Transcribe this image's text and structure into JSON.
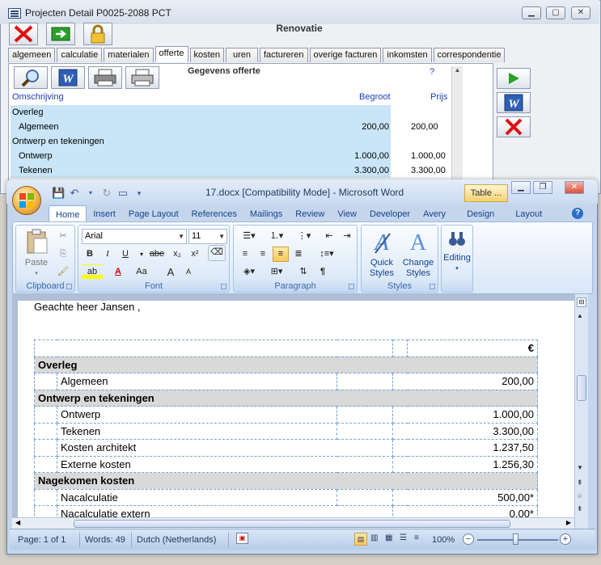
{
  "back_window": {
    "title": "Projecten Detail   P0025-2088   PCT",
    "header": "Renovatie",
    "tabs": [
      "algemeen",
      "calculatie",
      "materialen",
      "offerte",
      "kosten",
      "uren",
      "factureren",
      "overige facturen",
      "inkomsten",
      "correspondentie"
    ],
    "active_tab": "offerte",
    "section_title": "Gegevens offerte",
    "help_mark": "?",
    "columns": {
      "omschrijving": "Omschrijving",
      "begroot": "Begroot",
      "prijs": "Prijs"
    },
    "rows": [
      {
        "label": "Overleg",
        "begroot": "",
        "prijs": ""
      },
      {
        "label": "Algemeen",
        "begroot": "200,00",
        "prijs": "200,00"
      },
      {
        "label": "Ontwerp en tekeningen",
        "begroot": "",
        "prijs": ""
      },
      {
        "label": "Ontwerp",
        "begroot": "1.000,00",
        "prijs": "1.000,00"
      },
      {
        "label": "Tekenen",
        "begroot": "3.300,00",
        "prijs": "3.300,00"
      }
    ]
  },
  "word": {
    "title": "17.docx [Compatibility Mode] - Microsoft Word",
    "context_tab": "Table ...",
    "tabs": [
      "Home",
      "Insert",
      "Page Layout",
      "References",
      "Mailings",
      "Review",
      "View",
      "Developer",
      "Avery",
      "Design",
      "Layout"
    ],
    "active_tab": "Home",
    "groups": {
      "clipboard": "Clipboard",
      "font": "Font",
      "paragraph": "Paragraph",
      "styles": "Styles",
      "paste": "Paste",
      "quick_styles": "Quick Styles",
      "change_styles": "Change Styles",
      "editing": "Editing"
    },
    "font_name": "Arial",
    "font_size": "11",
    "font_buttons": {
      "bold": "B",
      "italic": "I",
      "underline": "U",
      "strike": "abe",
      "sub": "x₂",
      "sup": "x²",
      "grow": "A",
      "shrink": "A",
      "case": "Aa"
    },
    "document": {
      "greeting": "Geachte heer Jansen ,",
      "currency": "€",
      "rows": [
        {
          "type": "section",
          "label": "Overleg"
        },
        {
          "type": "item",
          "label": "Algemeen",
          "value": "200,00"
        },
        {
          "type": "section",
          "label": "Ontwerp en tekeningen"
        },
        {
          "type": "item",
          "label": "Ontwerp",
          "value": "1.000,00"
        },
        {
          "type": "item",
          "label": "Tekenen",
          "value": "3.300,00"
        },
        {
          "type": "item",
          "label": "Kosten architekt",
          "value": "1.237,50"
        },
        {
          "type": "item",
          "label": "Externe kosten",
          "value": "1.256,30"
        },
        {
          "type": "section",
          "label": "Nagekomen kosten"
        },
        {
          "type": "item",
          "label": "Nacalculatie",
          "value": "500,00*"
        },
        {
          "type": "item",
          "label": "Nacalculatie extern",
          "value": "0,00*"
        }
      ]
    },
    "status": {
      "page": "Page: 1 of 1",
      "words": "Words: 49",
      "language": "Dutch (Netherlands)",
      "zoom": "100%"
    }
  },
  "colors": {
    "row_highlight": "#c9e5f7",
    "link_blue": "#1a3fb8",
    "ribbon_text": "#15428b",
    "section_grey": "#d9d9d9"
  }
}
